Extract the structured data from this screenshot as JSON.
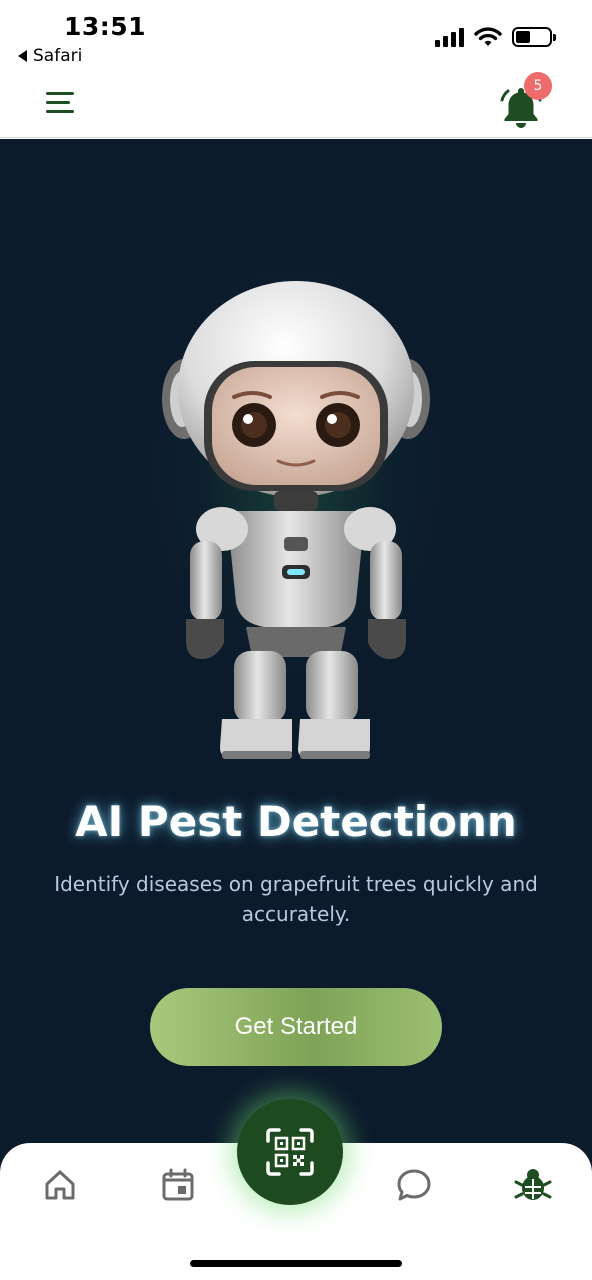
{
  "status_bar": {
    "time": "13:51",
    "back_app": "Safari",
    "battery_level": 0.45
  },
  "header": {
    "menu_icon": "hamburger-menu-icon",
    "bell_icon": "bell-icon",
    "notification_count": "5",
    "brand_color": "#1f4d22",
    "badge_color": "#ef6a6a"
  },
  "hero": {
    "image": "robot-mascot",
    "title": "AI Pest Detectionn",
    "subtitle": "Identify diseases on grapefruit trees quickly and accurately.",
    "cta_label": "Get Started",
    "background_color": "#0c1b2c",
    "cta_color": "#8fb366"
  },
  "bottom_nav": {
    "items": [
      {
        "name": "home",
        "icon": "home-icon"
      },
      {
        "name": "calendar",
        "icon": "calendar-icon"
      },
      {
        "name": "scan",
        "icon": "qr-scan-icon"
      },
      {
        "name": "chat",
        "icon": "chat-bubble-icon"
      },
      {
        "name": "pest",
        "icon": "bug-icon",
        "active": true
      }
    ],
    "active_color": "#1f4d22",
    "inactive_color": "#6b6b6b"
  }
}
